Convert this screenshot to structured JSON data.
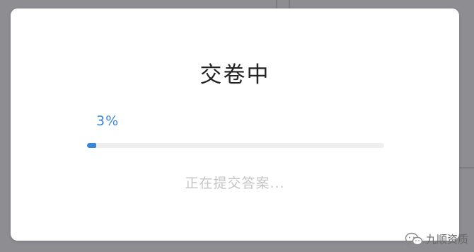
{
  "dialog": {
    "title": "交卷中",
    "progress_text": "3%",
    "progress_value": 0.03,
    "status_text": "正在提交答案..."
  },
  "watermark": {
    "text": "九顺资质",
    "icon": "wechat-icon"
  },
  "colors": {
    "accent": "#3a85d6",
    "track": "#efefef",
    "title": "#222222",
    "status": "#c5c5c8"
  }
}
